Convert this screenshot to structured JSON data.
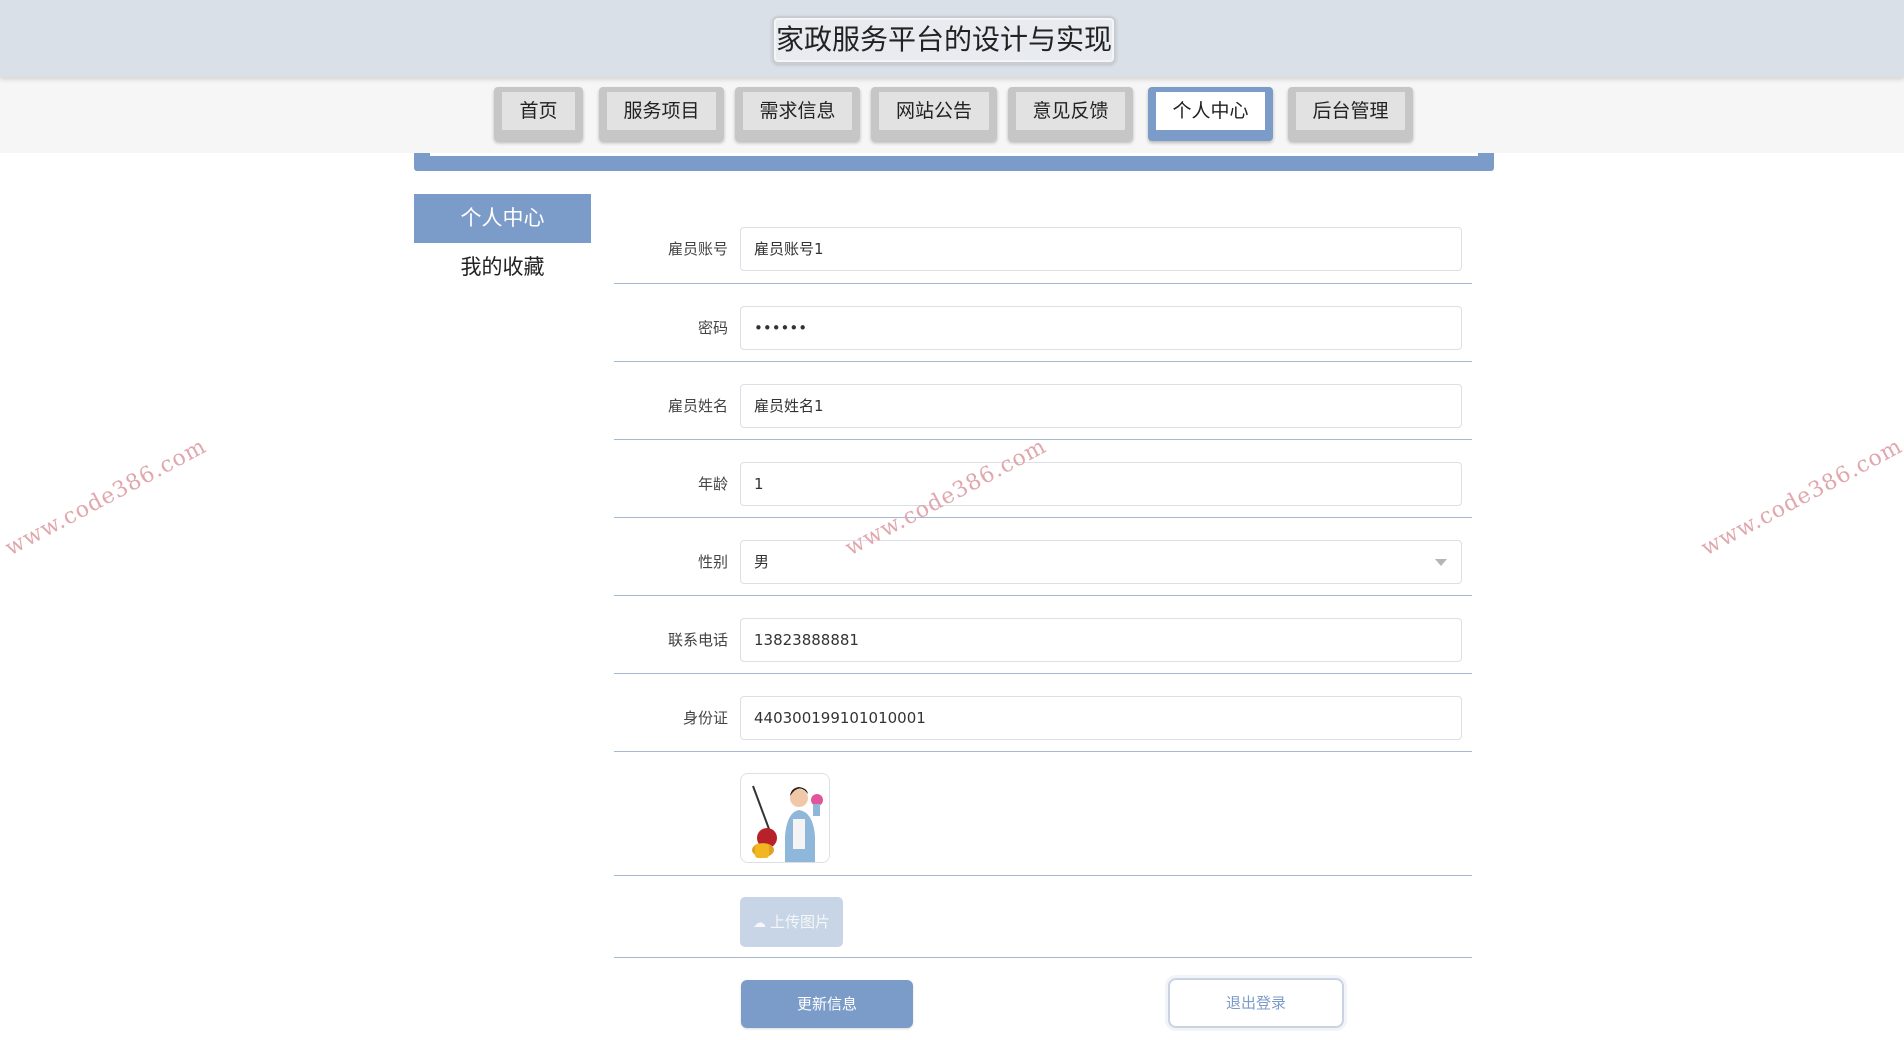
{
  "header": {
    "title": "家政服务平台的设计与实现"
  },
  "nav": {
    "items": [
      {
        "label": "首页"
      },
      {
        "label": "服务项目"
      },
      {
        "label": "需求信息"
      },
      {
        "label": "网站公告"
      },
      {
        "label": "意见反馈"
      },
      {
        "label": "个人中心",
        "active": true
      },
      {
        "label": "后台管理"
      }
    ]
  },
  "sidebar": {
    "items": [
      {
        "label": "个人中心",
        "active": true
      },
      {
        "label": "我的收藏"
      }
    ]
  },
  "form": {
    "account": {
      "label": "雇员账号",
      "value": "雇员账号1"
    },
    "password": {
      "label": "密码",
      "value": "••••••"
    },
    "name": {
      "label": "雇员姓名",
      "value": "雇员姓名1"
    },
    "age": {
      "label": "年龄",
      "value": "1"
    },
    "gender": {
      "label": "性别",
      "value": "男"
    },
    "phone": {
      "label": "联系电话",
      "value": "13823888881"
    },
    "id_card": {
      "label": "身份证",
      "value": "440300199101010001"
    },
    "upload_label": "上传图片"
  },
  "buttons": {
    "update": "更新信息",
    "logout": "退出登录"
  },
  "watermark": {
    "text": "www.code386.com"
  },
  "colors": {
    "accent": "#7b9bc8",
    "header_bg": "#dae0e8",
    "nav_bg": "#f6f6f6"
  }
}
